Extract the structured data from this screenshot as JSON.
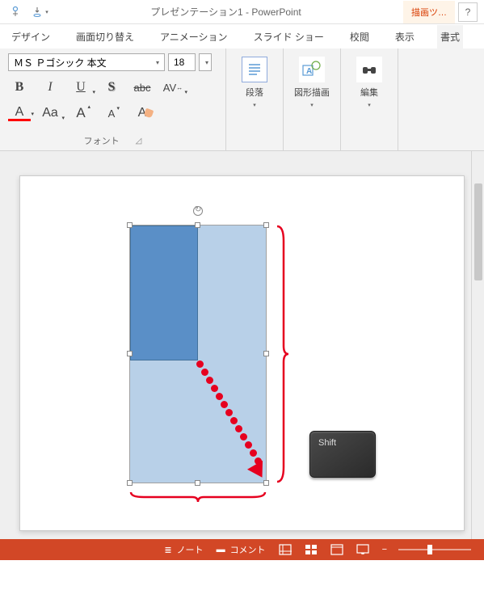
{
  "title": "プレゼンテーション1 - PowerPoint",
  "tool_tab": "描画ツ…",
  "help": "?",
  "tabs": {
    "design": "デザイン",
    "transitions": "画面切り替え",
    "animations": "アニメーション",
    "slideshow": "スライド ショー",
    "review": "校閲",
    "view": "表示",
    "format": "書式"
  },
  "font": {
    "name": "ＭＳ Ｐゴシック 本文",
    "size": "18",
    "group_label": "フォント",
    "strike_sample": "abc",
    "spacing": "AV",
    "case": "Aa",
    "grow": "A",
    "shrink": "A"
  },
  "groups": {
    "paragraph": "段落",
    "drawing": "図形描画",
    "editing": "編集"
  },
  "status": {
    "notes": "ノート",
    "comments": "コメント"
  },
  "shift_key": "Shift"
}
